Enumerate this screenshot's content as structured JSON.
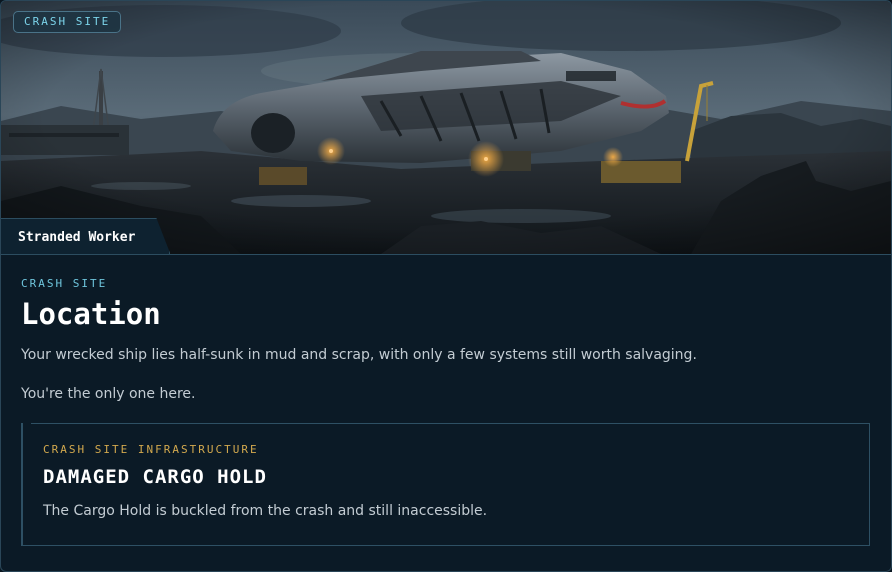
{
  "hero": {
    "badge_label": "CRASH SITE",
    "tab_label": "Stranded Worker",
    "image_subject": "wrecked-spaceship-crash-site"
  },
  "location": {
    "eyebrow": "CRASH SITE",
    "title": "Location",
    "description": "Your wrecked ship lies half-sunk in mud and scrap, with only a few systems still worth salvaging.",
    "occupancy": "You're the only one here."
  },
  "infrastructure": {
    "eyebrow": "CRASH SITE INFRASTRUCTURE",
    "title": "DAMAGED CARGO HOLD",
    "description": "The Cargo Hold is buckled from the crash and still inaccessible."
  },
  "colors": {
    "background": "#0b1a26",
    "accent_cyan": "#6fc6dd",
    "accent_gold": "#d3a94e",
    "border": "#2e5064"
  }
}
